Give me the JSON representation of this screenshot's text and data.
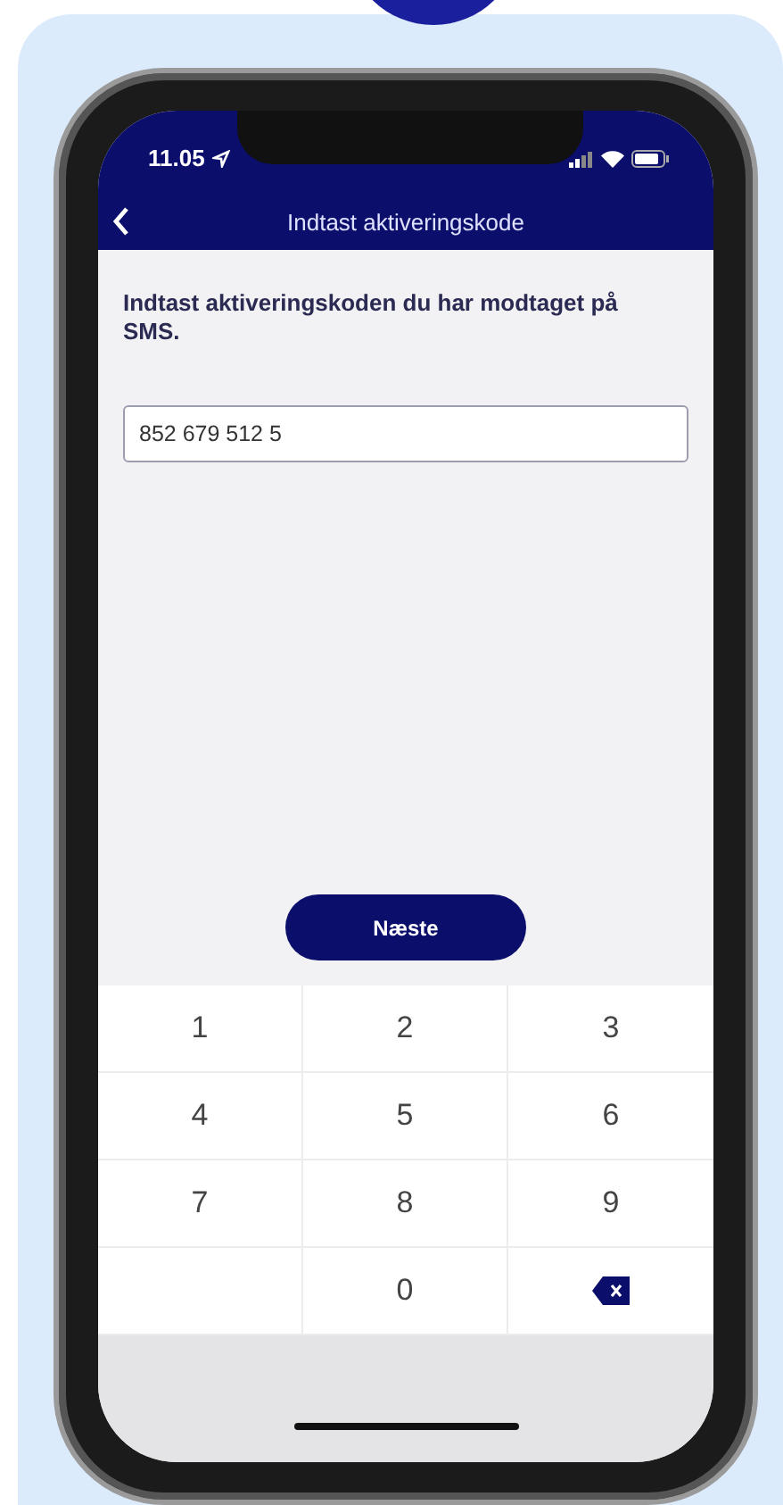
{
  "status_bar": {
    "time": "11.05"
  },
  "nav_bar": {
    "title": "Indtast aktiveringskode"
  },
  "prompt": "Indtast aktiveringskoden du har modtaget på SMS.",
  "code_field": {
    "value": "852 679 512 5"
  },
  "next_button": {
    "label": "Næste"
  },
  "keypad": [
    {
      "kind": "digit",
      "label": "1"
    },
    {
      "kind": "digit",
      "label": "2"
    },
    {
      "kind": "digit",
      "label": "3"
    },
    {
      "kind": "digit",
      "label": "4"
    },
    {
      "kind": "digit",
      "label": "5"
    },
    {
      "kind": "digit",
      "label": "6"
    },
    {
      "kind": "digit",
      "label": "7"
    },
    {
      "kind": "digit",
      "label": "8"
    },
    {
      "kind": "digit",
      "label": "9"
    },
    {
      "kind": "empty"
    },
    {
      "kind": "digit",
      "label": "0"
    },
    {
      "kind": "backspace"
    }
  ]
}
